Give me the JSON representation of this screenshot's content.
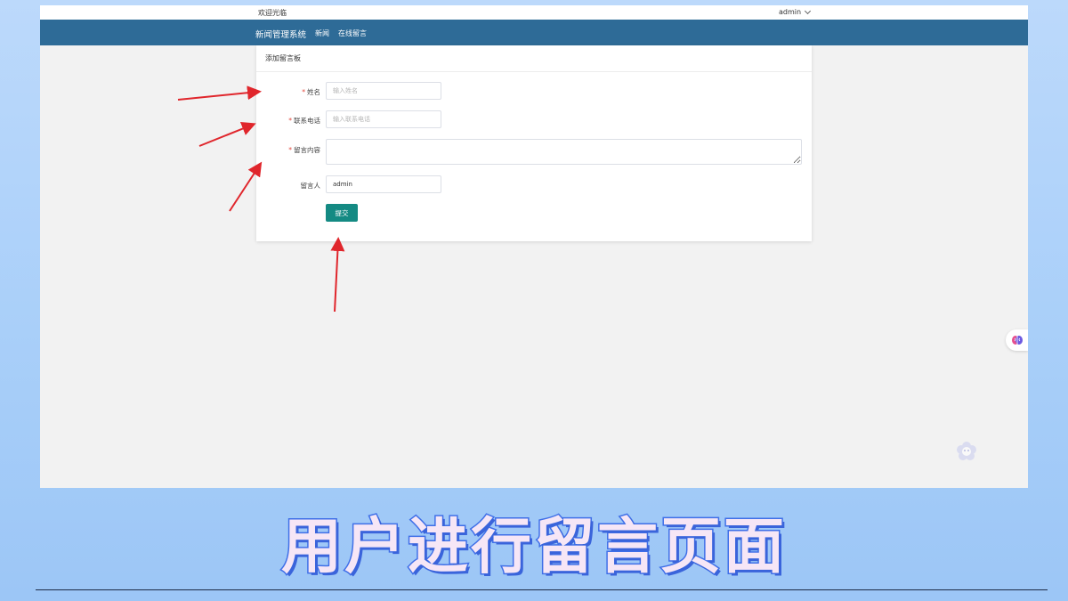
{
  "topbar": {
    "welcome": "欢迎光临",
    "user": "admin"
  },
  "navbar": {
    "brand": "新闻管理系统",
    "links": [
      "新闻",
      "在线留言"
    ]
  },
  "panel": {
    "title": "添加留言板"
  },
  "form": {
    "name": {
      "label": "姓名",
      "required": "*",
      "placeholder": "输入姓名",
      "value": ""
    },
    "phone": {
      "label": "联系电话",
      "required": "*",
      "placeholder": "输入联系电话",
      "value": ""
    },
    "content": {
      "label": "留言内容",
      "required": "*",
      "placeholder": "",
      "value": ""
    },
    "author": {
      "label": "留言人",
      "value": "admin"
    },
    "submit": "提交"
  },
  "caption": "用户进行留言页面",
  "colors": {
    "navbar": "#2e6b97",
    "submit": "#148a83",
    "arrow": "#e0262c",
    "caption_stroke": "#3f6fe8"
  },
  "icons": [
    "chevron-down-icon",
    "brain-icon",
    "flower-icon",
    "annotation-arrow"
  ]
}
